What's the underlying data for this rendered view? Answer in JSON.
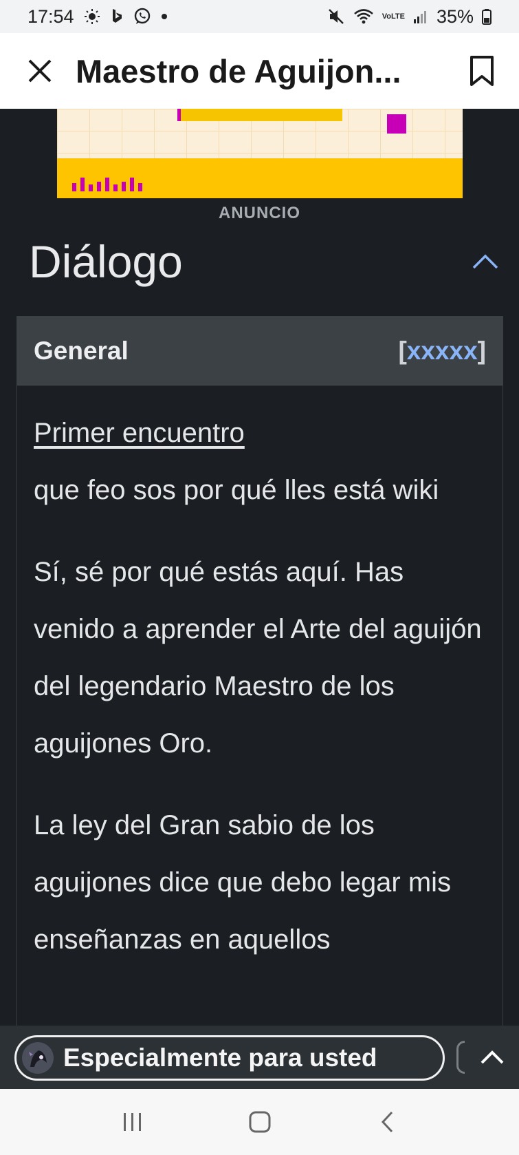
{
  "status_bar": {
    "time": "17:54",
    "battery": "35%",
    "network": "VoLTE"
  },
  "header": {
    "title": "Maestro de Aguijon...",
    "close_icon": "close-icon",
    "bookmark_icon": "bookmark-icon"
  },
  "ad": {
    "label": "ANUNCIO"
  },
  "section": {
    "title": "Diálogo"
  },
  "dialog": {
    "head_label": "General",
    "head_link_open": "[",
    "head_link_text": "xxxxx",
    "head_link_close": "]",
    "encounter_link": "Primer encuentro",
    "paragraphs": [
      "que feo sos por qué lles está wiki",
      "Sí, sé por qué estás aquí. Has venido a aprender el Arte del aguijón del legendario Maestro de los aguijones Oro.",
      "La ley del Gran sabio de los aguijones dice que debo legar mis enseñanzas en aquellos"
    ]
  },
  "bottom_bar": {
    "recommend_label": "Especialmente para usted"
  },
  "colors": {
    "page_bg": "#1b1f24",
    "link": "#8ab4f8",
    "ad_yellow": "#ffc400",
    "ad_magenta": "#c700b8"
  }
}
